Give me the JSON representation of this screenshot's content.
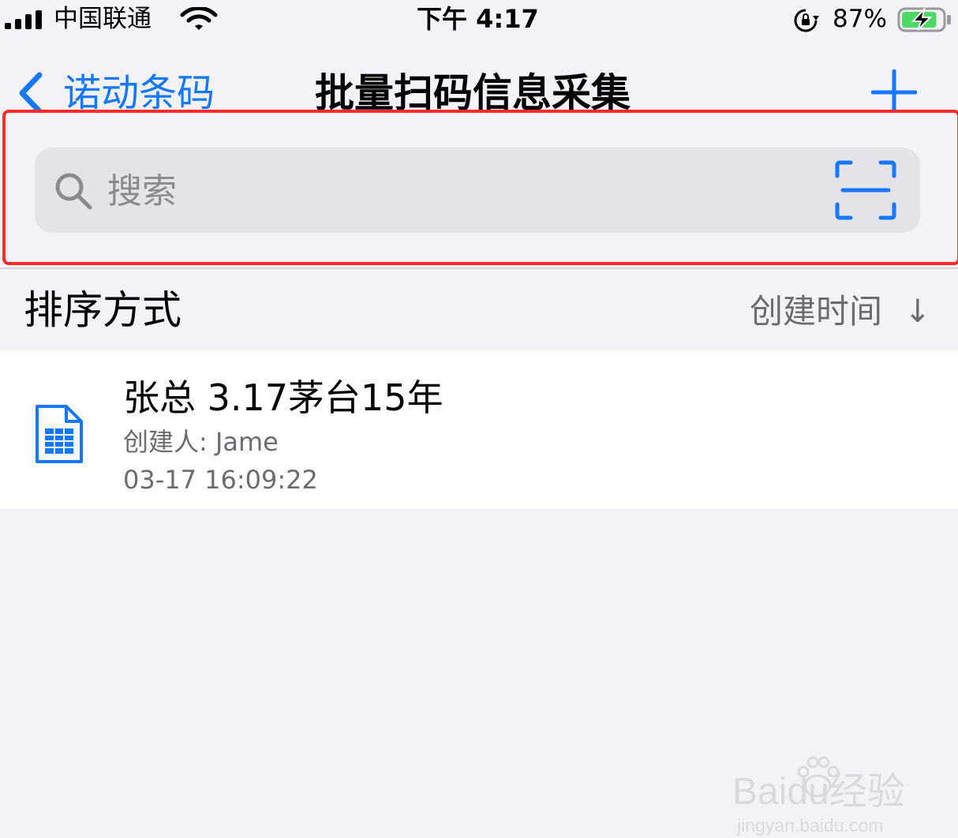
{
  "status_bar": {
    "carrier": "中国联通",
    "time": "下午 4:17",
    "battery_percent": "87%",
    "battery_level": 0.87
  },
  "nav": {
    "back_label": "诺动条码",
    "title": "批量扫码信息采集",
    "add_icon": "plus-icon"
  },
  "search": {
    "placeholder": "搜索",
    "value": "",
    "icons": [
      "search-icon",
      "scan-icon"
    ]
  },
  "sort": {
    "label": "排序方式",
    "value": "创建时间",
    "direction_icon": "↓"
  },
  "records": [
    {
      "title": "张总 3.17茅台15年",
      "creator": "创建人: Jame",
      "created_at": "03-17 16:09:22",
      "icon": "spreadsheet-file-icon"
    }
  ],
  "watermark": {
    "text": "Baidu经验",
    "sub": "jingyan.baidu.com"
  },
  "colors": {
    "accent": "#1677ff",
    "highlight": "#ff2a2a",
    "background": "#f2f2f7",
    "search_bg": "#e3e3e8",
    "battery_fill": "#4cd964"
  }
}
